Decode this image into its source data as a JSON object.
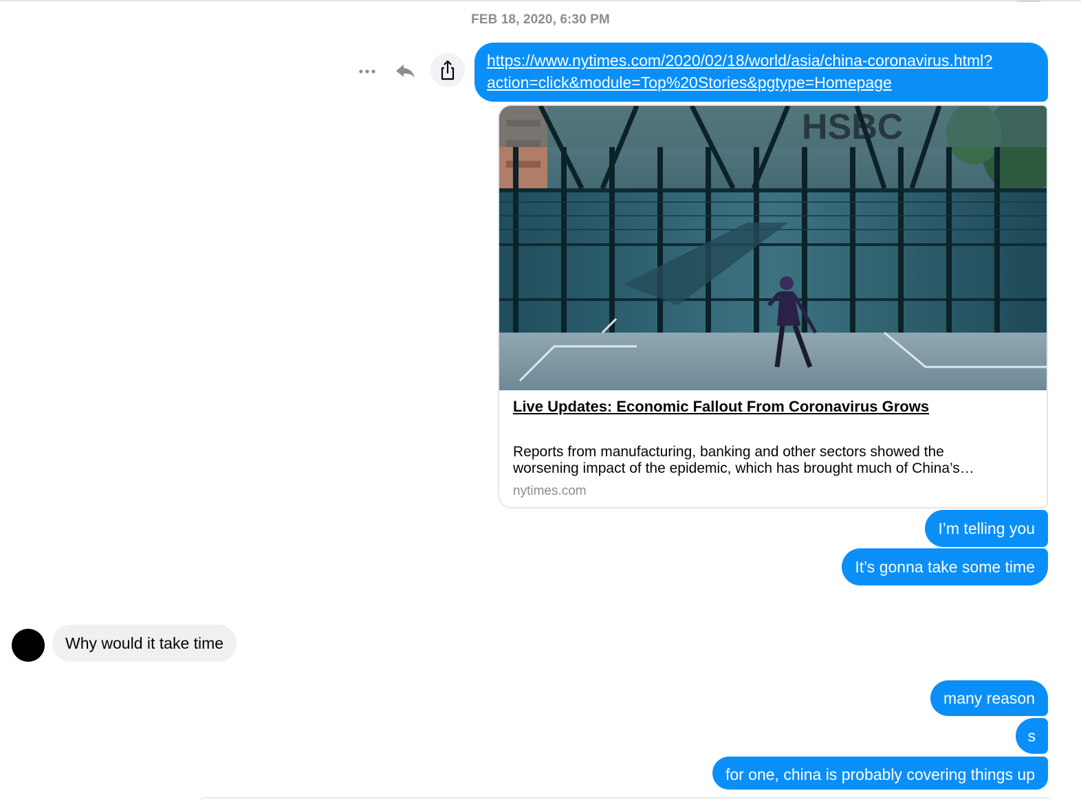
{
  "conversation": {
    "timestamp": "FEB 18, 2020, 6:30 PM"
  },
  "message_actions": {
    "more": "more-icon",
    "reply": "reply-icon",
    "share": "share-icon"
  },
  "link_message": {
    "url_line1": "https://www.nytimes.com/2020/02/18/world/asia/china-coronavirus.html?",
    "url_line2": "action=click&module=Top%20Stories&pgtype=Homepage",
    "preview": {
      "image_text": "HSBC",
      "title": "Live Updates: Economic Fallout From Coronavirus Grows",
      "description_line1": "Reports from manufacturing, banking and other sectors showed the",
      "description_line2": "worsening impact of the epidemic, which has brought much of China’s…",
      "domain": "nytimes.com"
    }
  },
  "messages": [
    {
      "direction": "outgoing",
      "text": "I’m telling you"
    },
    {
      "direction": "outgoing",
      "text": "It’s gonna take some time"
    },
    {
      "direction": "incoming",
      "text": "Why would it take time"
    },
    {
      "direction": "outgoing",
      "text": "many reason"
    },
    {
      "direction": "outgoing",
      "text": "s"
    },
    {
      "direction": "outgoing",
      "text": "for one, china is probably covering things up"
    }
  ],
  "colors": {
    "outgoing_bubble": "#0a8ff8",
    "incoming_bubble": "#f0f0f0",
    "timestamp": "#8a8d91"
  }
}
